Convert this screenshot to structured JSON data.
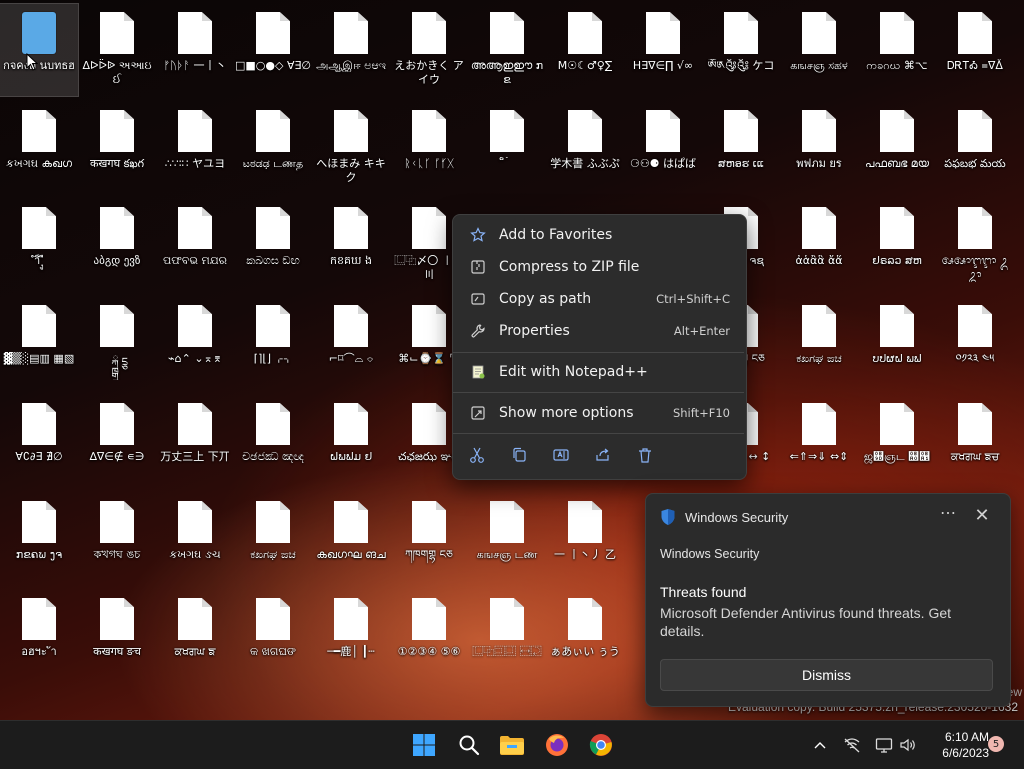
{
  "desktop": {
    "icons": [
      [
        "กจคงต นบทธฮ",
        "ᐃᐅᐇᐉ અઆઇઈ",
        "ᚠᚢᚦᚨ ⼀⼁⼂",
        "□■○●◇ ∀∃∅",
        "அஆஇஈ ಅಆಇ",
        "えおかきく アイウ",
        "അആഇഈ ກຂ",
        "M☉☾♂♀∑",
        "H∃∇∈∏ √∞",
        "ༀ༁༂༃ ケコ",
        "கஙசஞ ಸಹಳ",
        "ကခဂဃ ⌘⌥",
        "ᎠᎡᎢᎣ ᐀ᐁᐂ"
      ],
      [
        "કખગઘ കഖഗ",
        "कखगघ కఖగ",
        "∴∵∶∷ ヤユヨ",
        "ಟಠಡಢ டணத",
        "へほまみ キキク",
        "ᚱᚲᚳᚴ ᚵᚶᚷ",
        "็่้๊ ๋์",
        "学木書 ふぶぷ",
        "⚆⚇⚈ はぱば",
        "ສຫອຮ ເແ",
        "พฟภม ยร",
        "പഫബഭ മയ",
        "పఫబభ మయ"
      ],
      [
        "ำิีึ ืุู",
        "აბგდ ევზ",
        "ପଫବଭ ମଯର",
        "කඛගඝ ඞඟ",
        "កខគឃ ង",
        "⿺⿻〆〇 〡〢〣",
        "",
        "",
        "",
        "ກຂຄງ ຈຊ",
        "ἀἁἂἃ ἄἅ",
        "ຢຣລວ ສຫ",
        "ᬅᬆᬇᬈ ᬉᬊ"
      ],
      [
        "▓▒░▤▥ ▦▧",
        "ྐྑྒྒྷ ྔྕ",
        "⌁⌂⌃ ⌄⌅⌆",
        "⌈⌉⌊⌋ ⌌⌍",
        "⌐⌑⌒⌓ ⌔",
        "⌘⌙⌚⌛ ⌜⌝",
        "",
        "",
        "",
        "ཀཁགགྷ ངཅ",
        "ಕಖಗಘ ಙಚ",
        "ບປຜຝ ພຟ",
        "༠༡༢༣ ༤༥"
      ],
      [
        "∀∁∂∃ ∄∅",
        "∆∇∈∉ ∊∋",
        "万丈三上 下丌",
        "චඡජඣ ඤඥ",
        "ຝພຟມ ຢ",
        "చఛజఝ ఞట",
        "",
        "",
        "",
        "→←↑↓↔ ↕",
        "⇐⇑⇒⇓ ⇔⇕",
        "ஜ஝ஞட ஠஡",
        "ਕਖਗਘ ਙਚ"
      ],
      [
        "ກຂຄຆ ງຈ",
        "কখগঘ ঙচ",
        "કખગઘ ઙચ",
        "ಕಖಗಘ ಙಚ",
        "കഖഗഘ ങച",
        "ཀཁགགྷ ངཅ",
        "கஙசஞ டண",
        "⼀ ⼁⼂⼃ ⼄"
      ],
      [
        "อฮฯะ ัา",
        "कखगघ ङच",
        "ਕਖਗਘ ਙ",
        "କ ଖଗଘଙ",
        "─━鹿│ ┃┄",
        "①②③④ ⑤⑥",
        "⿺⿻⿼⿽ ⿾⿿",
        "ぁあぃい ぅう"
      ]
    ]
  },
  "context_menu": {
    "items": [
      {
        "icon": "star-icon",
        "label": "Add to Favorites",
        "shortcut": ""
      },
      {
        "icon": "zip-icon",
        "label": "Compress to ZIP file",
        "shortcut": ""
      },
      {
        "icon": "copy-path-icon",
        "label": "Copy as path",
        "shortcut": "Ctrl+Shift+C"
      },
      {
        "icon": "wrench-icon",
        "label": "Properties",
        "shortcut": "Alt+Enter"
      },
      {
        "icon": "notepad-plus-plus-icon",
        "label": "Edit with Notepad++",
        "shortcut": ""
      },
      {
        "icon": "more-options-icon",
        "label": "Show more options",
        "shortcut": "Shift+F10"
      }
    ],
    "actions": [
      "cut-icon",
      "copy-icon",
      "rename-icon",
      "share-icon",
      "delete-icon"
    ]
  },
  "toast": {
    "app_name": "Windows Security",
    "more": "⋯",
    "close": "✕",
    "subtitle": "Windows Security",
    "title": "Threats found",
    "message": "Microsoft Defender Antivirus found threats. Get details.",
    "button": "Dismiss"
  },
  "watermark": {
    "line1": "ew",
    "line2": "Evaluation copy. Build 25375.zn_release.230520-1632"
  },
  "taskbar": {
    "apps": [
      "windows-start-icon",
      "search-icon",
      "file-explorer-icon",
      "firefox-icon",
      "chrome-icon"
    ],
    "time": "6:10 AM",
    "date": "6/6/2023",
    "notification_count": "5"
  },
  "colors": {
    "accent": "#0078d4",
    "toast_bg": "#2b2b2b",
    "menu_bg": "#2c2c2c",
    "taskbar_bg": "#1c1c1c"
  }
}
